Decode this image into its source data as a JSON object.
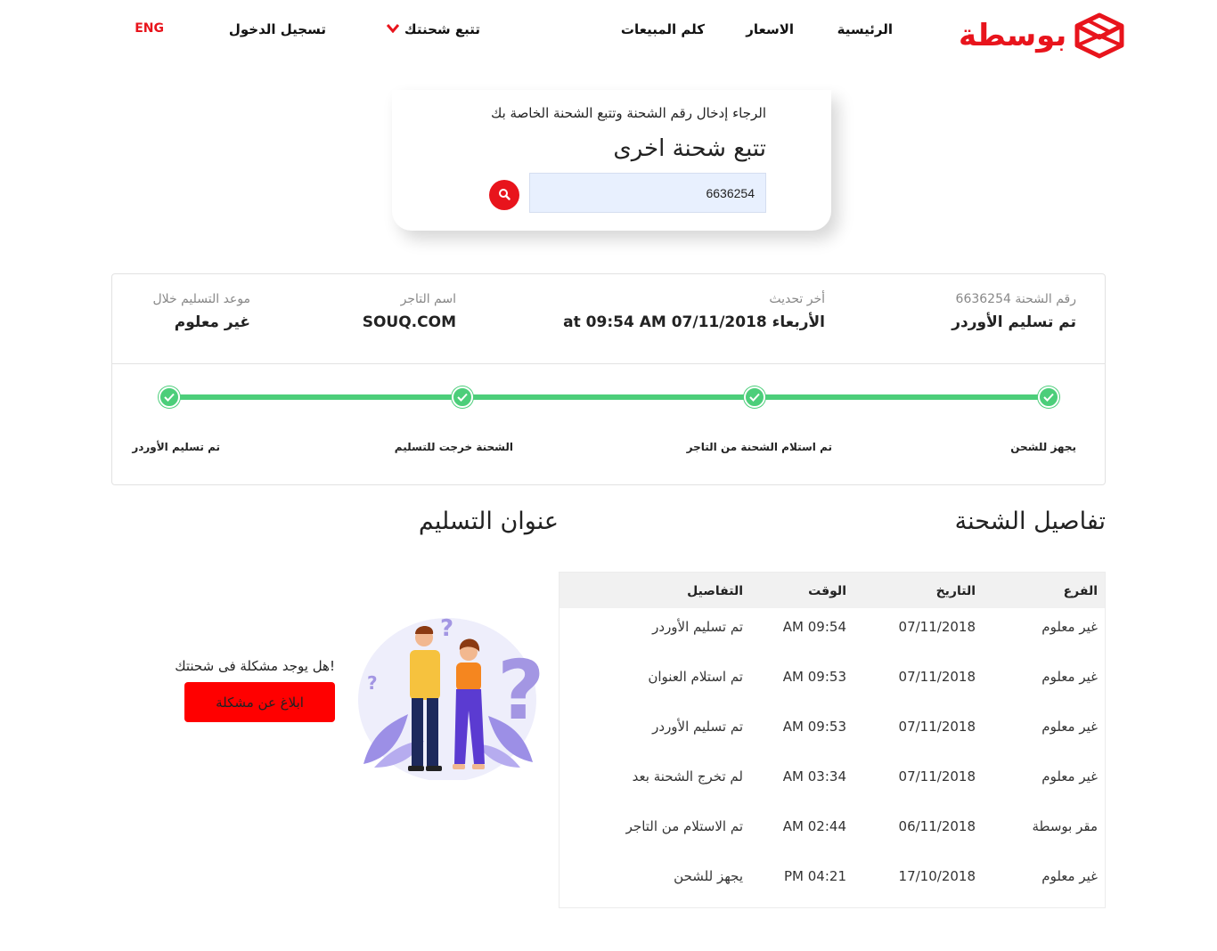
{
  "header": {
    "logo_text": "بوسطة",
    "nav": {
      "home": "الرئيسية",
      "prices": "الاسعار",
      "sales": "كلم المبيعات",
      "track": "تتبع شحنتك",
      "login": "تسجيل الدخول",
      "lang": "ENG"
    }
  },
  "search": {
    "hint": "الرجاء إدخال رقم الشحنة وتتبع الشحنة الخاصة بك",
    "title": "تتبع شحنة اخرى",
    "value": "6636254"
  },
  "summary": {
    "shipment_number_label": "رقم الشحنة 6636254",
    "status": "تم تسليم الأوردر",
    "last_update_label": "أخر تحديث",
    "last_update_value": "الأربعاء 07/11/2018 at 09:54 AM",
    "merchant_label": "اسم التاجر",
    "merchant_value": "SOUQ.COM",
    "eta_label": "موعد التسليم خلال",
    "eta_value": "غير معلوم"
  },
  "progress": {
    "steps": [
      {
        "label": "يجهز للشحن",
        "done": true
      },
      {
        "label": "تم استلام الشحنة من التاجر",
        "done": true
      },
      {
        "label": "الشحنة خرجت للتسليم",
        "done": true
      },
      {
        "label": "تم تسليم الأوردر",
        "done": true
      }
    ]
  },
  "sections": {
    "details_title": "تفاصيل الشحنة",
    "address_title": "عنوان التسليم"
  },
  "table": {
    "headers": {
      "branch": "الفرع",
      "date": "التاريخ",
      "time": "الوقت",
      "details": "التفاصيل"
    },
    "rows": [
      {
        "branch": "غير معلوم",
        "date": "07/11/2018",
        "time": "09:54 AM",
        "details": "تم تسليم الأوردر"
      },
      {
        "branch": "غير معلوم",
        "date": "07/11/2018",
        "time": "09:53 AM",
        "details": "تم استلام العنوان"
      },
      {
        "branch": "غير معلوم",
        "date": "07/11/2018",
        "time": "09:53 AM",
        "details": "تم تسليم الأوردر"
      },
      {
        "branch": "غير معلوم",
        "date": "07/11/2018",
        "time": "03:34 AM",
        "details": "لم تخرج الشحنة بعد"
      },
      {
        "branch": "مقر بوسطة",
        "date": "06/11/2018",
        "time": "02:44 AM",
        "details": "تم الاستلام من التاجر"
      },
      {
        "branch": "غير معلوم",
        "date": "17/10/2018",
        "time": "04:21 PM",
        "details": "يجهز للشحن"
      }
    ]
  },
  "problem": {
    "question": "!هل يوجد مشكلة فى شحنتك",
    "button_label": "ابلاغ عن مشكلة"
  },
  "colors": {
    "brand": "#e8141c",
    "progress": "#4cce7a",
    "report_button": "#ff0000"
  },
  "icons": {
    "logo": "box-logo-icon",
    "search": "search-icon",
    "chevron": "chevron-down-icon",
    "check": "check-icon"
  }
}
